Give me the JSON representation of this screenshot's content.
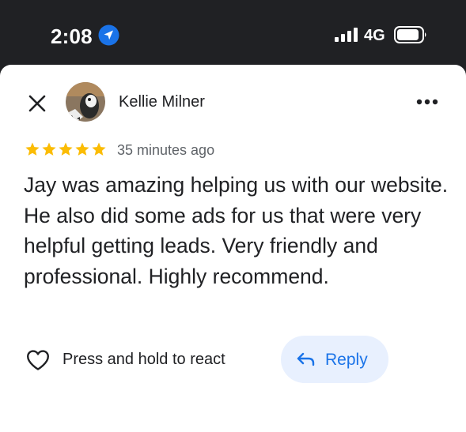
{
  "status_bar": {
    "time": "2:08",
    "network": "4G",
    "location_icon": "location-arrow-icon",
    "signal_icon": "signal-bars-icon",
    "battery_icon": "battery-icon"
  },
  "review": {
    "reviewer_name": "Kellie Milner",
    "rating": 5,
    "rating_max": 5,
    "timestamp": "35 minutes ago",
    "text": "Jay was amazing helping us with our website. He also did some ads for us that were very helpful getting leads. Very friendly and professional. Highly recommend."
  },
  "actions": {
    "react_label": "Press and hold to react",
    "reply_label": "Reply"
  },
  "colors": {
    "status_bar_bg": "#202124",
    "star": "#fbbc04",
    "reply_bg": "#e8f0fe",
    "reply_text": "#1a73e8",
    "location_badge": "#1a73e8"
  }
}
